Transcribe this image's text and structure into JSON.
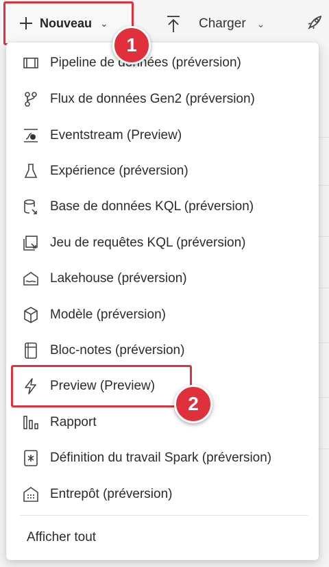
{
  "toolbar": {
    "new_label": "Nouveau",
    "upload_label": "Charger"
  },
  "menu": {
    "items": [
      {
        "label": "Pipeline de données (préversion)",
        "icon": "pipeline-icon"
      },
      {
        "label": "Flux de données Gen2 (préversion)",
        "icon": "dataflow-icon"
      },
      {
        "label": "Eventstream (Preview)",
        "icon": "eventstream-icon"
      },
      {
        "label": "Expérience (préversion)",
        "icon": "flask-icon"
      },
      {
        "label": "Base de données KQL (préversion)",
        "icon": "kql-database-icon"
      },
      {
        "label": "Jeu de requêtes KQL (préversion)",
        "icon": "kql-queryset-icon"
      },
      {
        "label": "Lakehouse (préversion)",
        "icon": "lakehouse-icon"
      },
      {
        "label": "Modèle (préversion)",
        "icon": "model-cube-icon"
      },
      {
        "label": "Bloc-notes (préversion)",
        "icon": "notebook-icon"
      },
      {
        "label": "Preview (Preview)",
        "icon": "lightning-icon"
      },
      {
        "label": "Rapport",
        "icon": "report-bars-icon"
      },
      {
        "label": "Définition du travail Spark (préversion)",
        "icon": "spark-job-icon"
      },
      {
        "label": "Entrepôt (préversion)",
        "icon": "warehouse-icon"
      }
    ],
    "show_all": "Afficher tout"
  },
  "annotations": {
    "step1": "1",
    "step2": "2"
  },
  "colors": {
    "highlight": "#e0303b",
    "menu_bg": "#ffffff"
  }
}
